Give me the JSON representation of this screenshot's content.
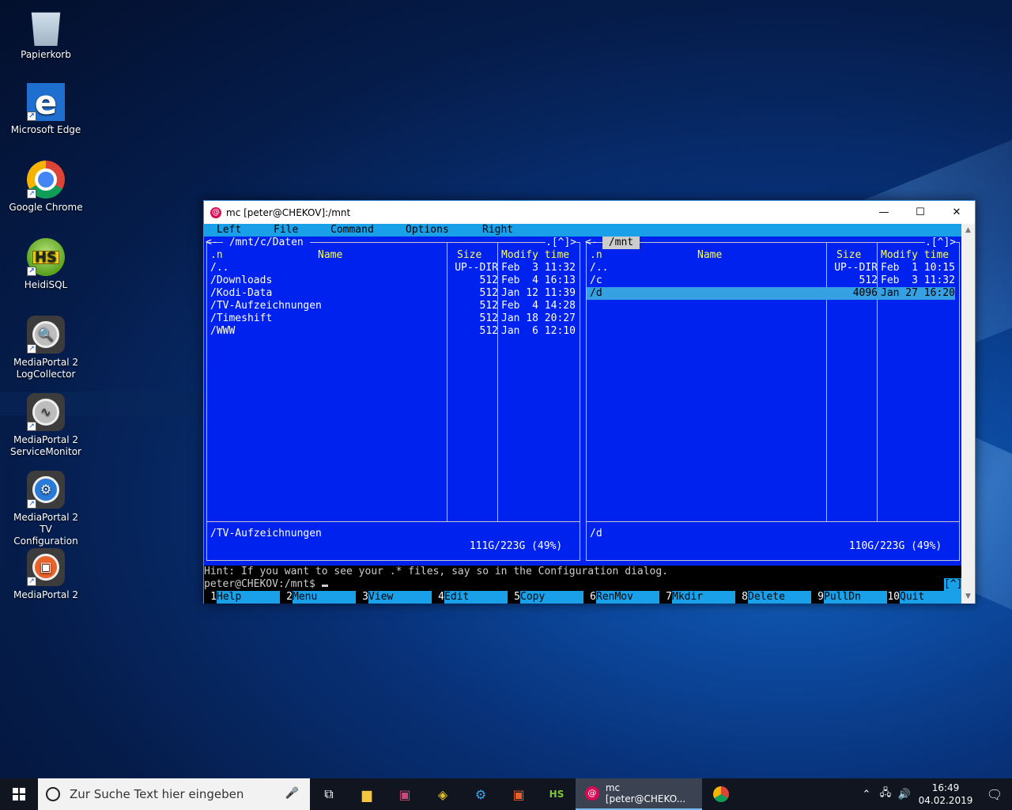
{
  "desktop": {
    "icons": [
      {
        "label": "Papierkorb",
        "icon": "recycle-bin-icon"
      },
      {
        "label": "Microsoft Edge",
        "icon": "edge-icon",
        "glyph": "e"
      },
      {
        "label": "Google Chrome",
        "icon": "chrome-icon"
      },
      {
        "label": "HeidiSQL",
        "icon": "heidisql-icon",
        "glyph": "HS"
      },
      {
        "label": "MediaPortal 2 LogCollector",
        "icon": "mediaportal-logcollector-icon",
        "glyph": "🔍"
      },
      {
        "label": "MediaPortal 2 ServiceMonitor",
        "icon": "mediaportal-servicemonitor-icon",
        "glyph": "∿"
      },
      {
        "label": "MediaPortal 2 TV Configuration",
        "icon": "mediaportal-tvconfig-icon",
        "glyph": "⚙"
      },
      {
        "label": "MediaPortal 2",
        "icon": "mediaportal-icon",
        "glyph": "▣"
      }
    ]
  },
  "window": {
    "title": "mc [peter@CHEKOV]:/mnt",
    "app_icon": "debian-swirl-icon",
    "controls": {
      "minimize": "—",
      "maximize": "☐",
      "close": "✕"
    }
  },
  "mc": {
    "menu": [
      "Left",
      "File",
      "Command",
      "Options",
      "Right"
    ],
    "left_panel": {
      "path": " /mnt/c/Daten ",
      "corner": ".[^]>",
      "headers": {
        "sort": ".n",
        "name": "Name",
        "size": "Size",
        "time": "Modify time"
      },
      "rows": [
        {
          "name": "/..",
          "size": "UP--DIR",
          "time": "Feb  3 11:32"
        },
        {
          "name": "/Downloads",
          "size": "512",
          "time": "Feb  4 16:13"
        },
        {
          "name": "/Kodi-Data",
          "size": "512",
          "time": "Jan 12 11:39"
        },
        {
          "name": "/TV-Aufzeichnungen",
          "size": "512",
          "time": "Feb  4 14:28"
        },
        {
          "name": "/Timeshift",
          "size": "512",
          "time": "Jan 18 20:27"
        },
        {
          "name": "/WWW",
          "size": "512",
          "time": "Jan  6 12:10"
        }
      ],
      "mini_status": "/TV-Aufzeichnungen",
      "free": " 111G/223G (49%) "
    },
    "right_panel": {
      "path": " /mnt ",
      "corner": ".[^]>",
      "headers": {
        "sort": ".n",
        "name": "Name",
        "size": "Size",
        "time": "Modify time"
      },
      "rows": [
        {
          "name": "/..",
          "size": "UP--DIR",
          "time": "Feb  1 10:15"
        },
        {
          "name": "/c",
          "size": "512",
          "time": "Feb  3 11:32"
        },
        {
          "name": "/d",
          "size": "4096",
          "time": "Jan 27 16:20",
          "selected": true
        }
      ],
      "mini_status": "/d",
      "free": " 110G/223G (49%) "
    },
    "hint": "Hint: If you want to see your .* files, say so in the Configuration dialog.",
    "prompt": "peter@CHEKOV:/mnt$ ",
    "caret_box": "[^]",
    "fkeys": [
      {
        "num": " 1",
        "label": "Help"
      },
      {
        "num": " 2",
        "label": "Menu"
      },
      {
        "num": " 3",
        "label": "View"
      },
      {
        "num": " 4",
        "label": "Edit"
      },
      {
        "num": " 5",
        "label": "Copy"
      },
      {
        "num": " 6",
        "label": "RenMov"
      },
      {
        "num": " 7",
        "label": "Mkdir"
      },
      {
        "num": " 8",
        "label": "Delete"
      },
      {
        "num": " 9",
        "label": "PullDn"
      },
      {
        "num": "10",
        "label": "Quit"
      }
    ]
  },
  "taskbar": {
    "search_placeholder": "Zur Suche Text hier eingeben",
    "active_app_label": "mc [peter@CHEKO...",
    "time": "16:49",
    "date": "04.02.2019"
  }
}
